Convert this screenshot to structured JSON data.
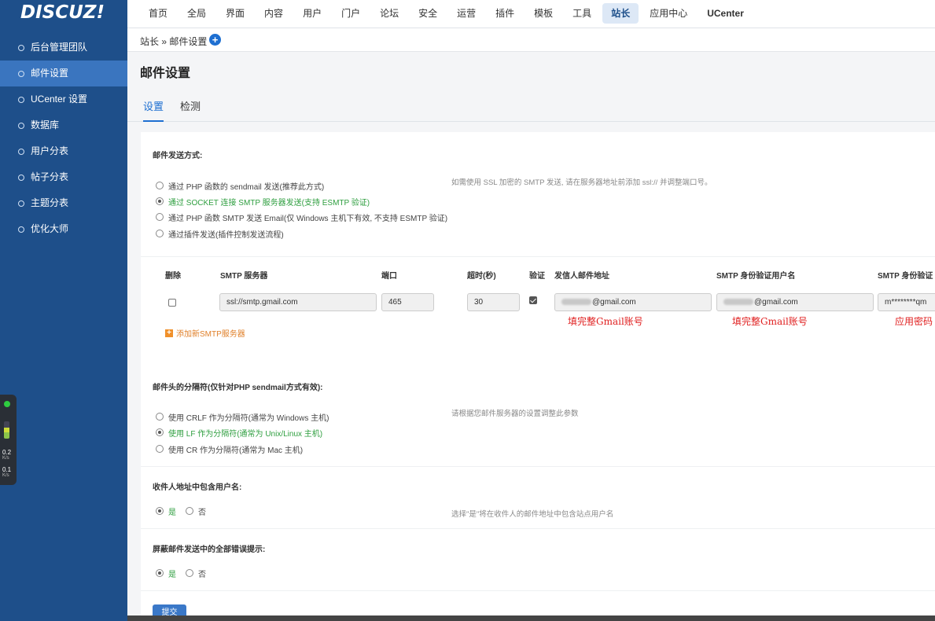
{
  "logo": "DISCUZ!",
  "topnav": [
    "首页",
    "全局",
    "界面",
    "内容",
    "用户",
    "门户",
    "论坛",
    "安全",
    "运营",
    "插件",
    "模板",
    "工具",
    "站长",
    "应用中心",
    "UCenter"
  ],
  "topnav_active": "站长",
  "sidebar": [
    "后台管理团队",
    "邮件设置",
    "UCenter 设置",
    "数据库",
    "用户分表",
    "帖子分表",
    "主题分表",
    "优化大师"
  ],
  "sidebar_active": "邮件设置",
  "breadcrumb": "站长 » 邮件设置",
  "page_title": "邮件设置",
  "tabs": [
    "设置",
    "检测"
  ],
  "send_method": {
    "title": "邮件发送方式:",
    "options": [
      "通过 PHP 函数的 sendmail 发送(推荐此方式)",
      "通过 SOCKET 连接 SMTP 服务器发送(支持 ESMTP 验证)",
      "通过 PHP 函数 SMTP 发送 Email(仅 Windows 主机下有效, 不支持 ESMTP 验证)",
      "通过插件发送(插件控制发送流程)"
    ],
    "selected": 1,
    "hint": "如需使用 SSL 加密的 SMTP 发送, 请在服务器地址前添加 ssl:// 并调整端口号。"
  },
  "smtp_table": {
    "headers": [
      "删除",
      "SMTP 服务器",
      "端口",
      "超时(秒)",
      "验证",
      "发信人邮件地址",
      "SMTP 身份验证用户名",
      "SMTP 身份验证"
    ],
    "server": "ssl://smtp.gmail.com",
    "port": "465",
    "timeout": "30",
    "sender": "@gmail.com",
    "username": "@gmail.com",
    "password": "m********qm",
    "notes": [
      "填完整Gmail账号",
      "填完整Gmail账号",
      "应用密码"
    ],
    "add_label": "添加新SMTP服务器"
  },
  "separator": {
    "title": "邮件头的分隔符(仅针对PHP sendmail方式有效):",
    "options": [
      "使用 CRLF 作为分隔符(通常为 Windows 主机)",
      "使用 LF 作为分隔符(通常为 Unix/Linux 主机)",
      "使用 CR 作为分隔符(通常为 Mac 主机)"
    ],
    "selected": 1,
    "hint": "请根据您邮件服务器的设置调整此参数"
  },
  "include_username": {
    "title": "收件人地址中包含用户名:",
    "yes": "是",
    "no": "否",
    "hint": "选择\"是\"将在收件人的邮件地址中包含站点用户名"
  },
  "suppress_errors": {
    "title": "屏蔽邮件发送中的全部错误提示:",
    "yes": "是",
    "no": "否"
  },
  "submit": "提交",
  "net_widget": {
    "up": "0.2",
    "up_unit": "K/s",
    "down": "0.1",
    "down_unit": "K/s"
  },
  "colors": {
    "sidebar": "#1e4f8a",
    "sidebar_active": "#3a75bf",
    "accent": "#1e6fd1",
    "green": "#2e9e3f",
    "note_red": "#e02020"
  }
}
